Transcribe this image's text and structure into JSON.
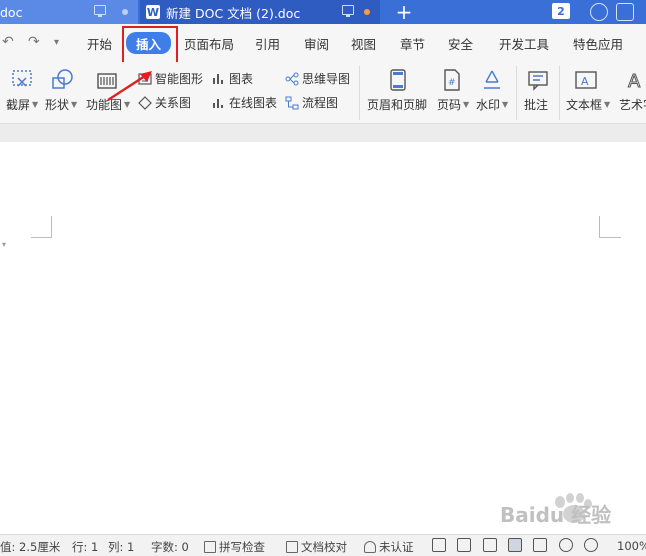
{
  "titlebar": {
    "tab1_label": "doc",
    "tab2_label": "新建 DOC 文档 (2).doc",
    "app_logo": "W",
    "new_tab": "+",
    "window_badge": "2"
  },
  "menu": {
    "items": [
      "开始",
      "插入",
      "页面布局",
      "引用",
      "审阅",
      "视图",
      "章节",
      "安全",
      "开发工具",
      "特色应用"
    ],
    "active": "插入"
  },
  "ribbon": {
    "screenshot": "截屏",
    "shape": "形状",
    "function_chart": "功能图",
    "smart_graphic": "智能图形",
    "chart": "图表",
    "mindmap": "思维导图",
    "relation": "关系图",
    "online_chart": "在线图表",
    "flowchart": "流程图",
    "header_footer": "页眉和页脚",
    "page_number": "页码",
    "watermark": "水印",
    "comment": "批注",
    "textbox": "文本框",
    "art": "艺术字"
  },
  "status": {
    "position": "值: 2.5厘米",
    "row": "行: 1",
    "col": "列: 1",
    "wordcount": "字数: 0",
    "spellcheck": "拼写检查",
    "proofread": "文档校对",
    "cert": "未认证",
    "zoom": "100%"
  },
  "colors": {
    "accent": "#3d7ee8",
    "titlebar": "#3b6fd8",
    "highlight": "#e02020"
  },
  "watermark_text": "Baidu 经验"
}
